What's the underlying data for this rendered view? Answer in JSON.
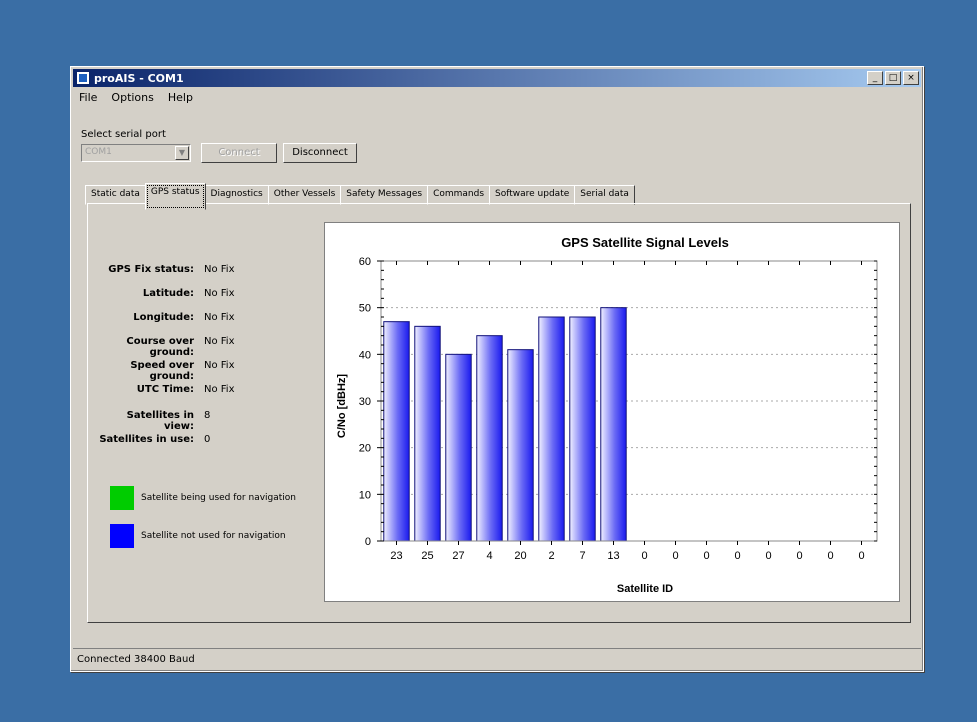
{
  "window": {
    "title": "proAIS - COM1"
  },
  "menu": [
    "File",
    "Options",
    "Help"
  ],
  "serial": {
    "label": "Select serial port",
    "port": "COM1",
    "connect_label": "Connect",
    "disconnect_label": "Disconnect"
  },
  "tabs": [
    "Static data",
    "GPS status",
    "Diagnostics",
    "Other Vessels",
    "Safety Messages",
    "Commands",
    "Software update",
    "Serial data"
  ],
  "gps": [
    {
      "label": "GPS Fix status:",
      "value": "No Fix"
    },
    {
      "label": "Latitude:",
      "value": "No Fix"
    },
    {
      "label": "Longitude:",
      "value": "No Fix"
    },
    {
      "label": "Course over ground:",
      "value": "No Fix"
    },
    {
      "label": "Speed over ground:",
      "value": "No Fix"
    },
    {
      "label": "UTC Time:",
      "value": "No Fix"
    },
    {
      "label": "Satellites in view:",
      "value": "8"
    },
    {
      "label": "Satellites in use:",
      "value": "0"
    }
  ],
  "legend": [
    {
      "label": "Satellite being used for navigation",
      "color": "#00cc00"
    },
    {
      "label": "Satellite not used for navigation",
      "color": "#0000ff"
    }
  ],
  "status": {
    "text": "Connected    38400 Baud"
  },
  "chart_data": {
    "type": "bar",
    "title": "GPS Satellite Signal Levels",
    "xlabel": "Satellite ID",
    "ylabel": "C/No [dBHz]",
    "categories": [
      "23",
      "25",
      "27",
      "4",
      "20",
      "2",
      "7",
      "13",
      "0",
      "0",
      "0",
      "0",
      "0",
      "0",
      "0",
      "0"
    ],
    "values": [
      47,
      46,
      40,
      44,
      41,
      48,
      48,
      50,
      0,
      0,
      0,
      0,
      0,
      0,
      0,
      0
    ],
    "ylim": [
      0,
      60
    ],
    "yticks": [
      0,
      10,
      20,
      30,
      40,
      50,
      60
    ],
    "grid": true,
    "bar_color": "#1a1aee"
  }
}
